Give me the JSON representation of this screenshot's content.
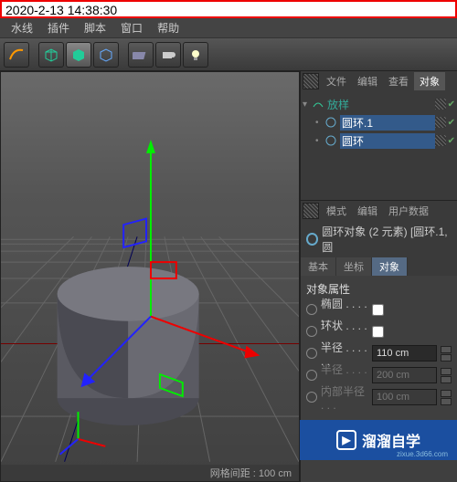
{
  "timestamp": "2020-2-13 14:38:30",
  "menu": [
    "水线",
    "插件",
    "脚本",
    "窗口",
    "帮助"
  ],
  "panel_tabs": {
    "file": "文件",
    "edit": "编辑",
    "view": "查看",
    "object": "对象"
  },
  "tree": {
    "sweep": "放样",
    "circle1": "圆环.1",
    "circle2": "圆环"
  },
  "attr_tabs": {
    "mode": "模式",
    "edit": "编辑",
    "user": "用户数据"
  },
  "attr_title": "圆环对象 (2 元素) [圆环.1, 圆",
  "attr_subtabs": {
    "basic": "基本",
    "coord": "坐标",
    "object": "对象"
  },
  "attr_section_head": "对象属性",
  "attr_rows": {
    "ellipse": "椭圆 . . . . . .",
    "ring": "环状 . . . . . .",
    "radius": "半径 . . . . . .",
    "radius_val": "110 cm",
    "radius2": "半径 . . . . . .",
    "radius2_val": "200 cm",
    "inner": "内部半径 . . .",
    "inner_val": "100 cm"
  },
  "status": "网格间距 : 100 cm",
  "watermark": {
    "text": "溜溜自学",
    "url": "zixue.3d66.com"
  }
}
